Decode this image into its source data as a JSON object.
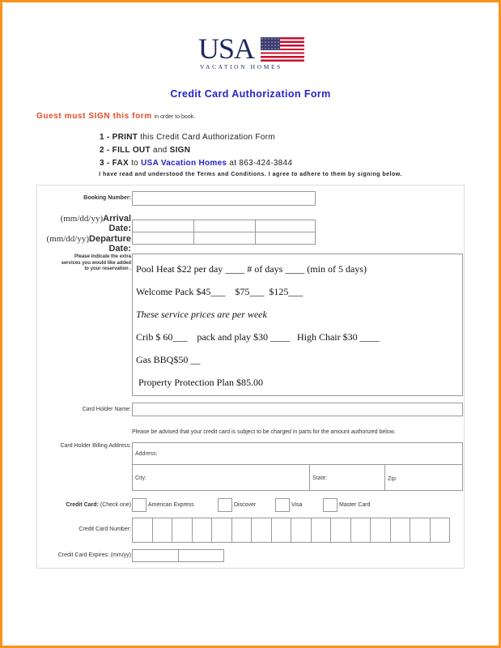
{
  "logo": {
    "main": "USA",
    "sub": "VACATION HOMES",
    "flag_icon": "us-flag-icon"
  },
  "title": "Credit Card Authorization Form",
  "guest_notice": {
    "emphasis": "Guest must SIGN this form",
    "rest": "in order to book."
  },
  "steps": [
    {
      "num": "1 - ",
      "action": "PRINT",
      "text": " this Credit Card Authorization Form"
    },
    {
      "num": "2 - ",
      "action": "FILL OUT",
      "text": " and ",
      "action2": "SIGN"
    },
    {
      "num": "3 - ",
      "action": "FAX",
      "text": " to ",
      "company": "USA Vacation Homes",
      "text2": " at 863-424-3844"
    }
  ],
  "agreement": "I have read and understood the Terms and Conditions. I agree to adhere to them by signing below.",
  "form": {
    "booking_number_label": "Booking Number:",
    "arrival_prefix": "(mm/dd/yy)",
    "arrival_label": "Arrival",
    "arrival_label2": "Date:",
    "departure_prefix": "(mm/dd/yy)",
    "departure_label": "Departure",
    "departure_label2": "Date:",
    "extras_label_1": "Please indicate the extra",
    "extras_label_2": "services you would like added",
    "extras_label_3": "to your reservation .",
    "services": [
      "Pool Heat $22 per day ____ # of days ____ (min of 5 days)",
      "Welcome Pack $45___    $75___  $125___",
      "These service prices are per week",
      "Crib $ 60___    pack and play $30 ____   High Chair $30 ____",
      "Gas BBQ$50 __",
      " Property Protection Plan $85.00"
    ],
    "card_holder_name_label": "Card Holder Name:",
    "charge_notice": "Please be advised that your credit card is subject to be charged in parts for the amount authorized below.",
    "billing_address_label": "Card Holder Billing Address:",
    "address_label": "Address:",
    "city_label": "City:",
    "state_label": "State:",
    "zip_label": "Zip:",
    "credit_card_label": "Credit Card:",
    "credit_card_hint": "(Check one)",
    "card_types": [
      "American Express",
      "Discover",
      "Visa",
      "Master Card"
    ],
    "card_number_label": "Credit Card Number:",
    "card_number_digits": 16,
    "expires_label": "Credit Card Expires: (mm/yy)"
  }
}
